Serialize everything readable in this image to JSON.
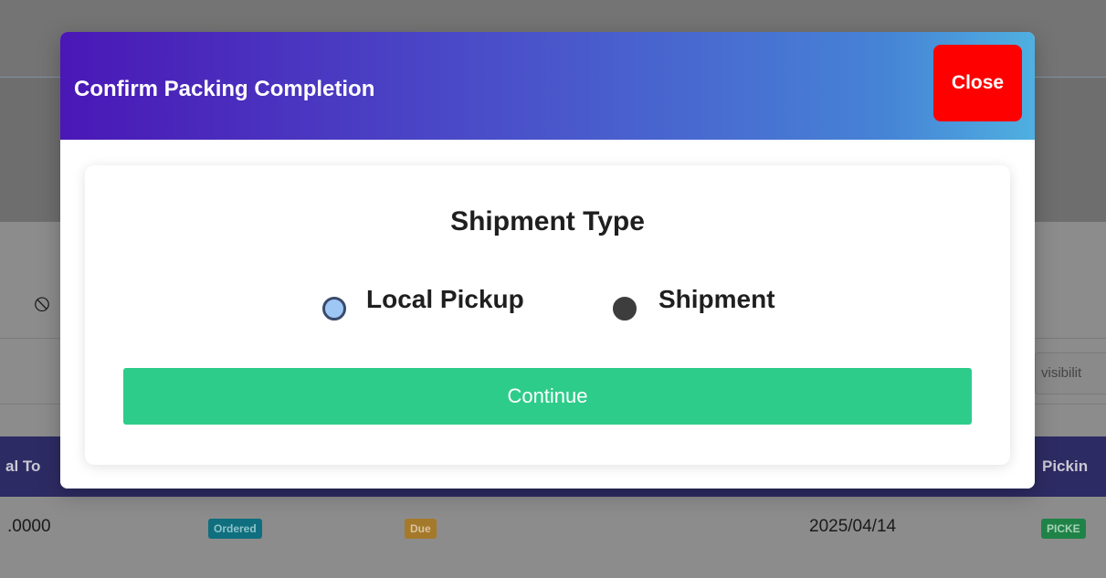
{
  "background": {
    "ban_icon": "ban-icon",
    "search_input_value": "visibilit",
    "table_headers": [
      "al To",
      "Pickin"
    ],
    "row": {
      "total": ".0000",
      "status_badge": "Ordered",
      "payment_badge": "Due",
      "date": "2025/04/14",
      "picking_badge": "PICKE"
    }
  },
  "modal": {
    "title": "Confirm Packing Completion",
    "close_label": "Close",
    "section_title": "Shipment Type",
    "options": [
      {
        "label": "Local Pickup",
        "selected": false,
        "focused": true
      },
      {
        "label": "Shipment",
        "selected": true
      }
    ],
    "continue_label": "Continue"
  },
  "colors": {
    "header_gradient_start": "#4a17b6",
    "header_gradient_end": "#4fb0e0",
    "close_button": "#ff0000",
    "continue_button": "#2ecc8a"
  }
}
